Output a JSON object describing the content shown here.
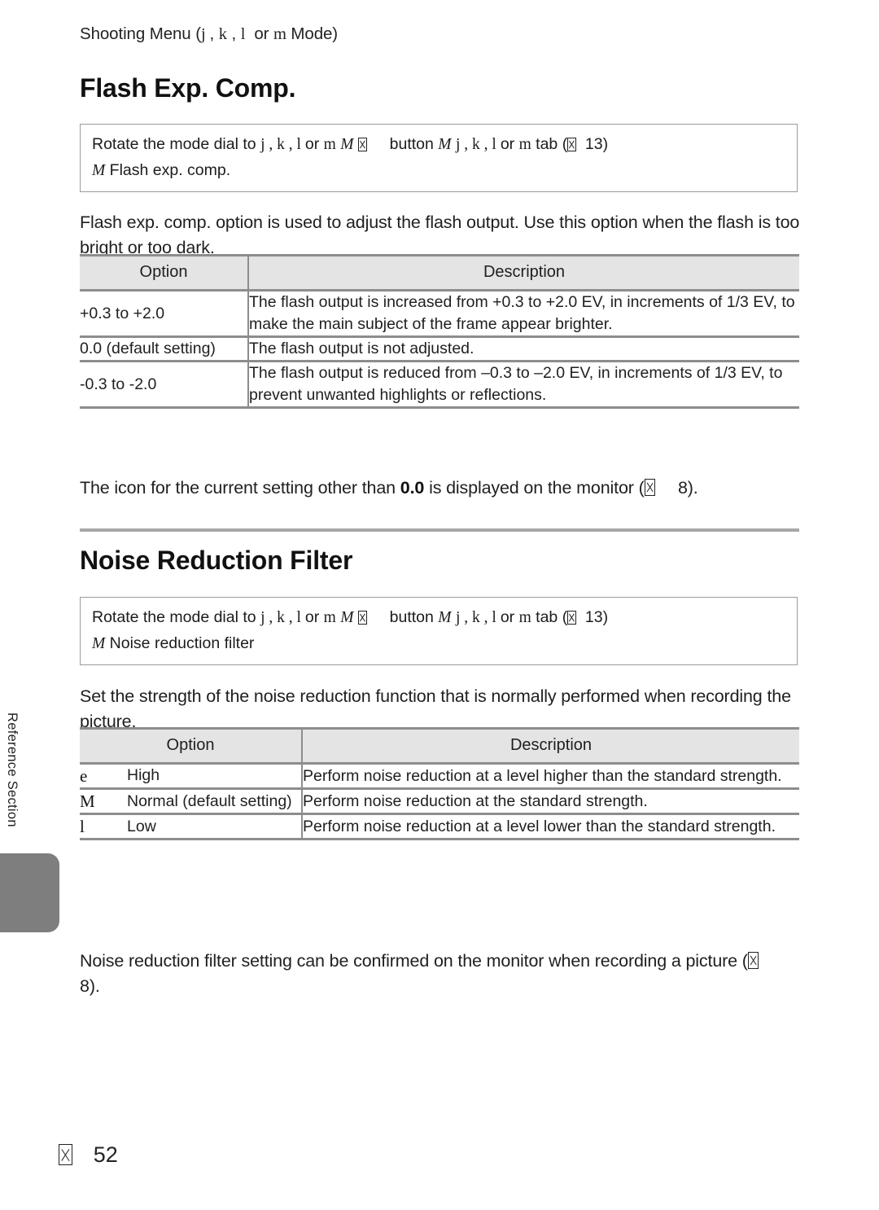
{
  "document": {
    "running_header": {
      "prefix": "Shooting Menu (",
      "modes": [
        "j",
        "k",
        "l"
      ],
      "conjunction": "or",
      "last_mode": "m",
      "suffix": "Mode)"
    },
    "side_tab_label": "Reference Section",
    "footer": {
      "symbol": "page-reference-icon",
      "page_number": "52"
    }
  },
  "sections": [
    {
      "id": "flash-exp-comp",
      "title": "Flash Exp. Comp.",
      "navbox": {
        "line1_a": "Rotate the mode dial to",
        "line1_modes": "j , k , l",
        "line1_or": "or",
        "line1_m": "m",
        "line1_menu_icon": "M",
        "line1_b": "button",
        "line1_menu_icon2": "M",
        "line1_modes2": "j , k , l",
        "line1_or2": "or",
        "line1_m2": "m",
        "line1_tab": "tab",
        "line1_ref_open": "(",
        "line1_ref_page": "13",
        "line1_ref_close": ")",
        "line2_icon": "M",
        "line2_text": "Flash exp. comp."
      },
      "intro": "Flash exp. comp. option is used to adjust the flash output. Use this option when the flash is too bright or too dark.",
      "table": {
        "headers": [
          "Option",
          "Description"
        ],
        "rows": [
          {
            "option": "+0.3 to +2.0",
            "description": "The flash output is increased from +0.3 to +2.0 EV, in increments of 1/3 EV, to make the main subject of the frame appear brighter."
          },
          {
            "option": "0.0 (default setting)",
            "description": "The flash output is not adjusted."
          },
          {
            "option": "-0.3 to -2.0",
            "description": "The flash output is reduced from –0.3 to –2.0 EV, in increments of 1/3 EV, to prevent unwanted highlights or reflections."
          }
        ]
      },
      "note": {
        "a": "The icon for the current setting other than",
        "bold": "0.0",
        "b": "is displayed on the monitor (",
        "ref_page": "8",
        "c": ")."
      }
    },
    {
      "id": "noise-reduction-filter",
      "title": "Noise Reduction Filter",
      "navbox": {
        "line1_a": "Rotate the mode dial to",
        "line1_modes": "j , k , l",
        "line1_or": "or",
        "line1_m": "m",
        "line1_menu_icon": "M",
        "line1_b": "button",
        "line1_menu_icon2": "M",
        "line1_modes2": "j , k , l",
        "line1_or2": "or",
        "line1_m2": "m",
        "line1_tab": "tab",
        "line1_ref_open": "(",
        "line1_ref_page": "13",
        "line1_ref_close": ")",
        "line2_icon": "M",
        "line2_text": "Noise reduction filter"
      },
      "intro": "Set the strength of the noise reduction function that is normally performed when recording the picture.",
      "table": {
        "headers": [
          "Option",
          "Description"
        ],
        "rows": [
          {
            "icon": "e",
            "option": "High",
            "description": "Perform noise reduction at a level higher than the standard strength."
          },
          {
            "icon": "M",
            "option": "Normal (default setting)",
            "description": "Perform noise reduction at the standard strength."
          },
          {
            "icon": "l",
            "option": "Low",
            "description": "Perform noise reduction at a level lower than the standard strength."
          }
        ]
      },
      "note": {
        "a": "Noise reduction filter setting can be confirmed on the monitor when recording a picture (",
        "ref_page": "8",
        "c": ")."
      }
    }
  ]
}
